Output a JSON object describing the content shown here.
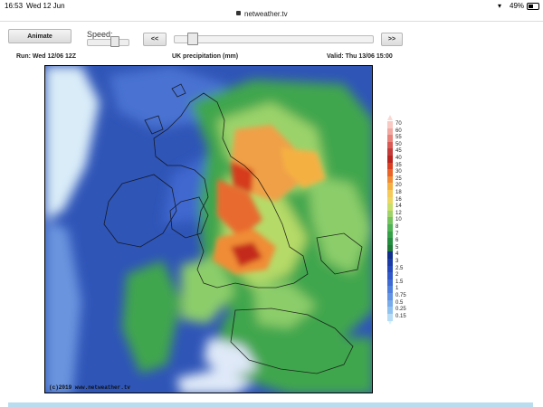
{
  "status": {
    "time": "16:53",
    "date": "Wed 12 Jun",
    "url": "netweather.tv",
    "battery": "49%"
  },
  "controls": {
    "animate_label": "Animate",
    "speed_label": "Speed:",
    "prev_label": "<<",
    "next_label": ">>",
    "speed_level": 0.65,
    "frame_position": 0.07
  },
  "header": {
    "run": "Run: Wed 12/06 12Z",
    "title": "UK precipitation (mm)",
    "valid": "Valid: Thu 13/06 15:00"
  },
  "map": {
    "copyright": "(c)2019 www.netweather.tv"
  },
  "legend": [
    {
      "label": "70",
      "color": "#f7c9c2"
    },
    {
      "label": "60",
      "color": "#f1a8a0"
    },
    {
      "label": "55",
      "color": "#e8837c"
    },
    {
      "label": "50",
      "color": "#d95a55"
    },
    {
      "label": "45",
      "color": "#c43c39"
    },
    {
      "label": "40",
      "color": "#b9241f"
    },
    {
      "label": "35",
      "color": "#d93f20"
    },
    {
      "label": "30",
      "color": "#e86428"
    },
    {
      "label": "25",
      "color": "#f08c36"
    },
    {
      "label": "20",
      "color": "#f5b042"
    },
    {
      "label": "18",
      "color": "#f5c95a"
    },
    {
      "label": "16",
      "color": "#ecd664"
    },
    {
      "label": "14",
      "color": "#c7de6b"
    },
    {
      "label": "12",
      "color": "#9fd26a"
    },
    {
      "label": "10",
      "color": "#74c35f"
    },
    {
      "label": "8",
      "color": "#4fb254"
    },
    {
      "label": "7",
      "color": "#36a048"
    },
    {
      "label": "6",
      "color": "#248c3e"
    },
    {
      "label": "5",
      "color": "#1c7a36"
    },
    {
      "label": "4",
      "color": "#102f8c"
    },
    {
      "label": "3",
      "color": "#1a3ba5"
    },
    {
      "label": "2.5",
      "color": "#2448b9"
    },
    {
      "label": "2",
      "color": "#3058c8"
    },
    {
      "label": "1.5",
      "color": "#3e6ad4"
    },
    {
      "label": "1",
      "color": "#4f7fdc"
    },
    {
      "label": "0.75",
      "color": "#6294e3"
    },
    {
      "label": "0.5",
      "color": "#78abea"
    },
    {
      "label": "0.25",
      "color": "#90c2f0"
    },
    {
      "label": "0.15",
      "color": "#b6dcf6"
    }
  ]
}
